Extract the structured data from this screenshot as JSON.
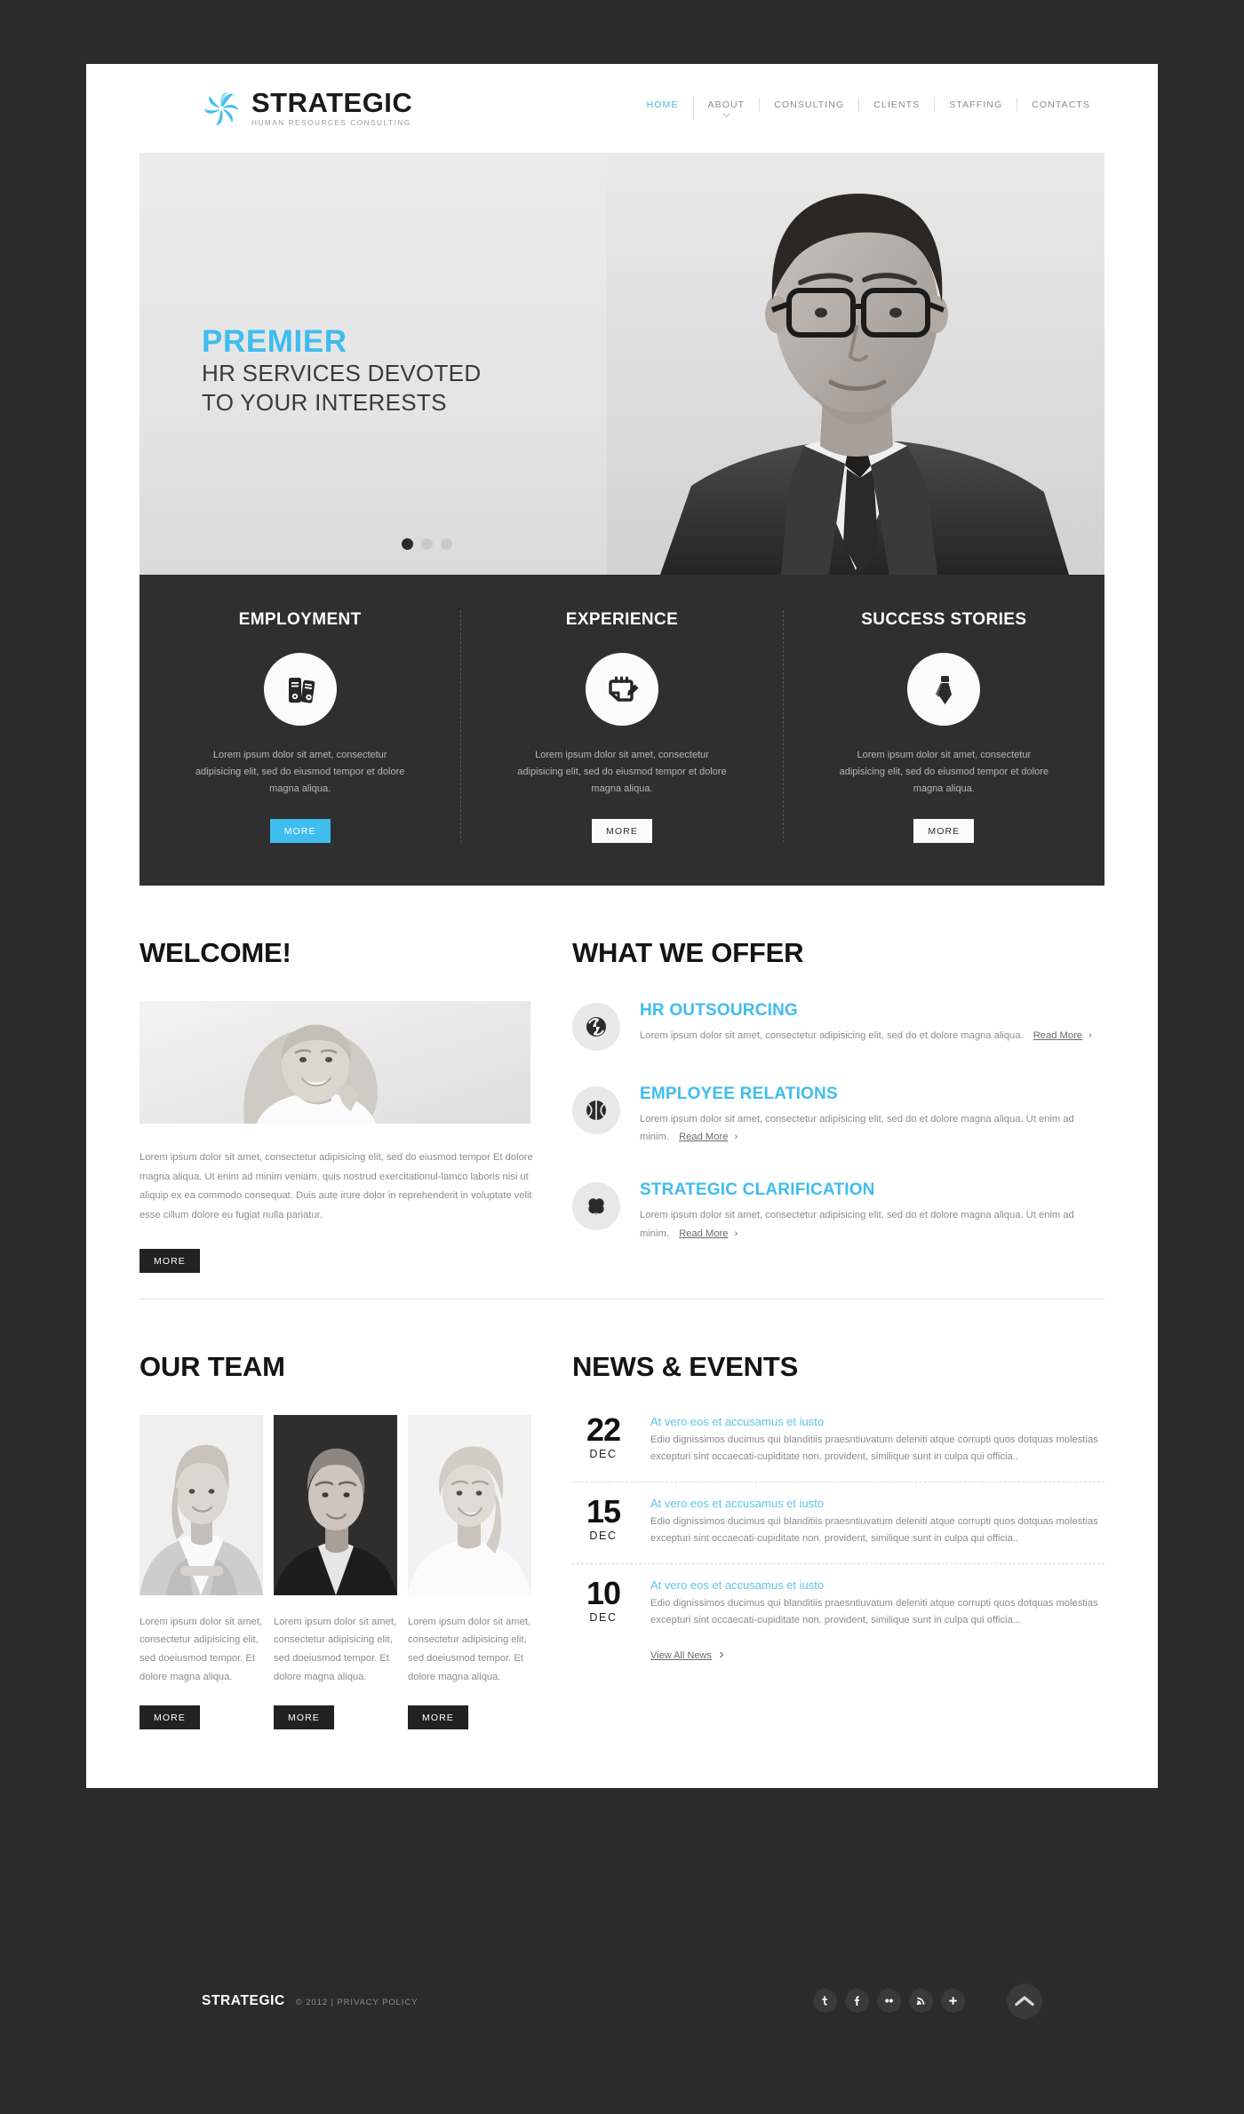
{
  "site": {
    "logo_icon": "pinwheel-logo-icon",
    "brand_title": "STRATEGIC",
    "brand_subtitle": "HUMAN RESOURCES CONSULTING",
    "accent_color": "#3fbdee",
    "dark_color": "#2f2f2f"
  },
  "nav": {
    "items": [
      {
        "label": "HOME",
        "active": true,
        "caret": false
      },
      {
        "label": "ABOUT",
        "active": false,
        "caret": true
      },
      {
        "label": "CONSULTING",
        "active": false,
        "caret": false
      },
      {
        "label": "CLIENTS",
        "active": false,
        "caret": false
      },
      {
        "label": "STAFFING",
        "active": false,
        "caret": false
      },
      {
        "label": "CONTACTS",
        "active": false,
        "caret": false
      }
    ]
  },
  "hero": {
    "kicker": "PREMIER",
    "line1": "HR SERVICES DEVOTED",
    "line2": "TO YOUR INTERESTS",
    "slides": 3,
    "active_slide": 1
  },
  "features": [
    {
      "title": "EMPLOYMENT",
      "icon": "binders-icon",
      "text": "Lorem ipsum dolor sit amet, consectetur adipisicing elit, sed do eiusmod tempor et dolore magna aliqua.",
      "button": "MORE",
      "button_style": "cyan"
    },
    {
      "title": "EXPERIENCE",
      "icon": "notepad-pencil-icon",
      "text": "Lorem ipsum dolor sit amet, consectetur adipisicing elit, sed do eiusmod tempor et dolore magna aliqua.",
      "button": "MORE",
      "button_style": "white"
    },
    {
      "title": "SUCCESS STORIES",
      "icon": "necktie-icon",
      "text": "Lorem ipsum dolor sit amet, consectetur adipisicing elit, sed do eiusmod tempor et dolore magna aliqua.",
      "button": "MORE",
      "button_style": "white"
    }
  ],
  "welcome": {
    "heading": "WELCOME!",
    "image_alt": "smiling-businesswoman-photo",
    "text": "Lorem ipsum dolor sit amet, consectetur adipisicing elit, sed do eiusmod tempor Et dolore magna aliqua. Ut enim ad minim veniam, quis nostrud exercitationul-lamco laboris nisi ut aliquip ex ea commodo consequat. Duis aute irure dolor in reprehenderit in voluptate velit esse cillum dolore eu fugiat nulla pariatur.",
    "button": "MORE"
  },
  "offers": {
    "heading": "WHAT WE OFFER",
    "items": [
      {
        "title": "HR OUTSOURCING",
        "icon": "recycle-arrows-icon",
        "text": "Lorem ipsum dolor sit amet, consectetur adipisicing elit, sed do et dolore magna aliqua.",
        "read_more": "Read More",
        "chevron": "›"
      },
      {
        "title": "EMPLOYEE RELATIONS",
        "icon": "basketball-icon",
        "text": "Lorem ipsum dolor sit amet, consectetur adipisicing elit, sed do et dolore magna aliqua. Ut enim ad minim.",
        "read_more": "Read More",
        "chevron": "›"
      },
      {
        "title": "STRATEGIC CLARIFICATION",
        "icon": "clover-icon",
        "text": "Lorem ipsum dolor sit amet, consectetur adipisicing elit, sed do et dolore magna aliqua. Ut enim ad minim.",
        "read_more": "Read More",
        "chevron": "›"
      }
    ]
  },
  "team": {
    "heading": "OUR TEAM",
    "members": [
      {
        "photo_alt": "team-member-photo-1",
        "text": "Lorem ipsum dolor sit amet, consectetur adipisicing elit, sed doeiusmod tempor. Et dolore magna aliqua.",
        "button": "MORE"
      },
      {
        "photo_alt": "team-member-photo-2",
        "text": "Lorem ipsum dolor sit amet, consectetur adipisicing elit, sed doeiusmod tempor. Et dolore magna aliqua.",
        "button": "MORE"
      },
      {
        "photo_alt": "team-member-photo-3",
        "text": "Lorem ipsum dolor sit amet, consectetur adipisicing elit, sed doeiusmod tempor. Et dolore magna aliqua.",
        "button": "MORE"
      }
    ]
  },
  "news": {
    "heading": "NEWS & EVENTS",
    "items": [
      {
        "day": "22",
        "month": "DEC",
        "title": "At vero eos et accusamus et iusto",
        "body": "Edio dignissimos ducimus qui blanditiis praesntiuvatum deleniti atque corrupti quos dotquas molestias excepturi sint occaecati-cupiditate non. provident, similique sunt in culpa qui officia.."
      },
      {
        "day": "15",
        "month": "DEC",
        "title": "At vero eos et accusamus et iusto",
        "body": "Edio dignissimos ducimus qui blanditiis praesntiuvatum deleniti atque corrupti quos dotquas molestias excepturi sint occaecati-cupiditate non. provident, similique sunt in culpa qui officia.."
      },
      {
        "day": "10",
        "month": "DEC",
        "title": "At vero eos et accusamus et iusto",
        "body": "Edio dignissimos ducimus qui blanditiis praesntiuvatum deleniti atque corrupti quos dotquas molestias excepturi sint occaecati-cupiditate non. provident, similique sunt in culpa qui officia..."
      }
    ],
    "view_all": "View All News",
    "view_all_chevron": "›"
  },
  "footer": {
    "brand": "STRATEGIC",
    "copyright": "© 2012 | PRIVACY POLICY",
    "socials": [
      {
        "name": "twitter-icon",
        "glyph": "t"
      },
      {
        "name": "facebook-icon",
        "glyph": "f"
      },
      {
        "name": "flickr-icon",
        "glyph": "••"
      },
      {
        "name": "rss-icon",
        "glyph": "rss"
      },
      {
        "name": "plus-icon",
        "glyph": "+"
      }
    ],
    "back_to_top": "back-to-top-icon"
  }
}
